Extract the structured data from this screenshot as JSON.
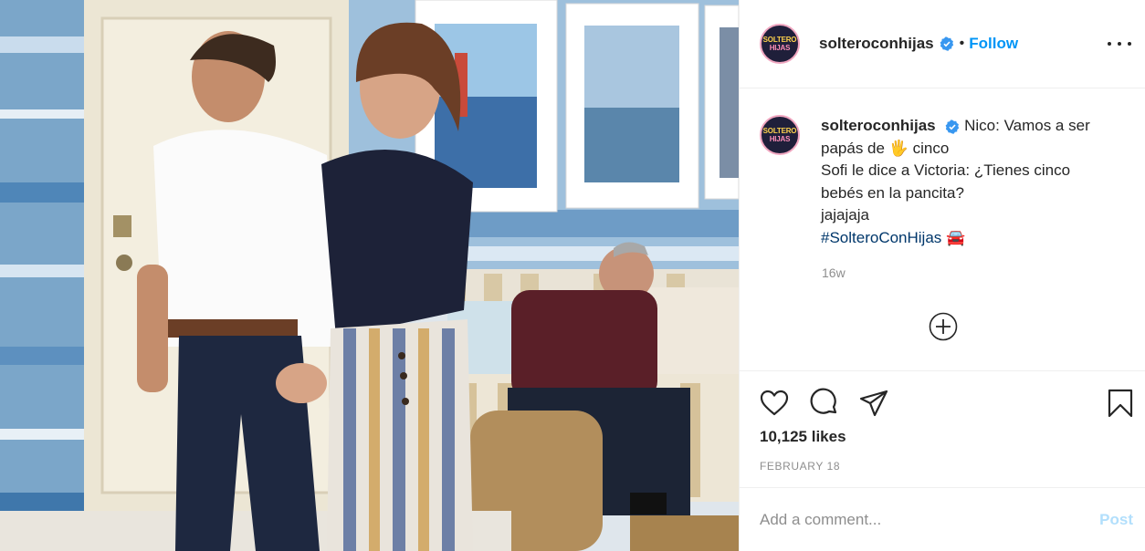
{
  "post": {
    "username": "solteroconhijas",
    "follow_label": "Follow",
    "separator": "•",
    "avatar_text_top": "SOLTERO",
    "avatar_text_bottom": "HIJAS",
    "caption": {
      "line1": "Nico: Vamos a ser",
      "line2_a": "papás de",
      "line2_emoji": "🖐",
      "line2_b": "cinco",
      "line3": "Sofi le dice a Victoria: ¿Tienes cinco",
      "line4": "bebés en la pancita?",
      "line5": "jajajaja",
      "hashtag": "#SolteroConHijas",
      "hashtag_emoji": "🚘"
    },
    "time_ago": "16w",
    "likes": "10,125 likes",
    "date": "FEBRUARY 18",
    "comment_placeholder": "Add a comment...",
    "post_label": "Post"
  },
  "icons": {
    "verified": "verified-badge-icon",
    "more": "more-options-icon",
    "load_more": "plus-circle-icon",
    "like": "heart-icon",
    "comment": "comment-bubble-icon",
    "share": "paper-plane-icon",
    "save": "bookmark-icon"
  },
  "colors": {
    "follow": "#0095f6",
    "hashtag": "#00376b",
    "muted": "#8e8e8e",
    "post_disabled": "#b2dffc"
  }
}
